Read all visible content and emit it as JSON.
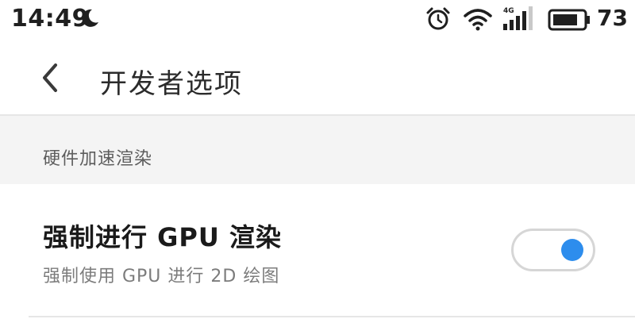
{
  "status_bar": {
    "time": "14:49",
    "network_type": "4G",
    "battery_level": "73"
  },
  "header": {
    "title": "开发者选项",
    "back_icon": "chevron-left-icon"
  },
  "section": {
    "label": "硬件加速渲染"
  },
  "setting": {
    "title": "强制进行 GPU 渲染",
    "description": "强制使用 GPU 进行 2D 绘图",
    "toggle_on": true
  },
  "colors": {
    "accent": "#2d8ded",
    "section_bg": "#f4f4f4",
    "divider": "#e6e6e6"
  }
}
